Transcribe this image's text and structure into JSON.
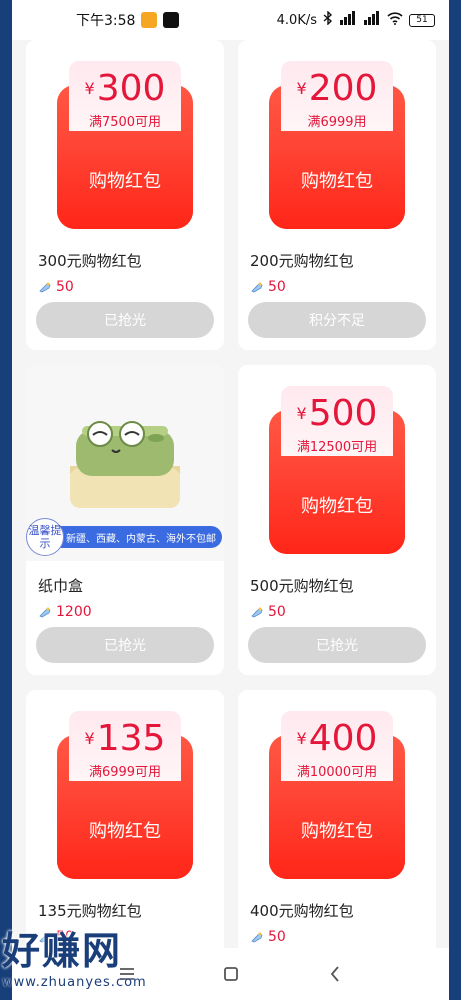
{
  "status_bar": {
    "time": "下午3:58",
    "network_speed": "4.0K/s",
    "battery": "51"
  },
  "cards": [
    {
      "type": "redpacket",
      "amount": "300",
      "condition": "满7500可用",
      "envelope_label": "购物红包",
      "title": "300元购物红包",
      "points": "50",
      "button": "已抢光"
    },
    {
      "type": "redpacket",
      "amount": "200",
      "condition": "满6999用",
      "envelope_label": "购物红包",
      "title": "200元购物红包",
      "points": "50",
      "button": "积分不足"
    },
    {
      "type": "product",
      "title": "纸巾盒",
      "points": "1200",
      "button": "已抢光",
      "tip_label": "温馨提示",
      "tip_text": "新疆、西藏、内蒙古、海外不包邮"
    },
    {
      "type": "redpacket",
      "amount": "500",
      "condition": "满12500可用",
      "envelope_label": "购物红包",
      "title": "500元购物红包",
      "points": "50",
      "button": "已抢光"
    },
    {
      "type": "redpacket",
      "amount": "135",
      "condition": "满6999可用",
      "envelope_label": "购物红包",
      "title": "135元购物红包",
      "points": "50",
      "button": ""
    },
    {
      "type": "redpacket",
      "amount": "400",
      "condition": "满10000可用",
      "envelope_label": "购物红包",
      "title": "400元购物红包",
      "points": "50",
      "button": ""
    }
  ],
  "currency_symbol": "¥",
  "watermark": {
    "title": "好赚网",
    "url": "www.zhuanyes.com"
  },
  "colors": {
    "accent_red": "#e4163a",
    "envelope_red": "#ff2d1d",
    "button_disabled": "#d6d6d6",
    "tip_blue": "#3b6be0",
    "frame_blue": "#17407a"
  }
}
